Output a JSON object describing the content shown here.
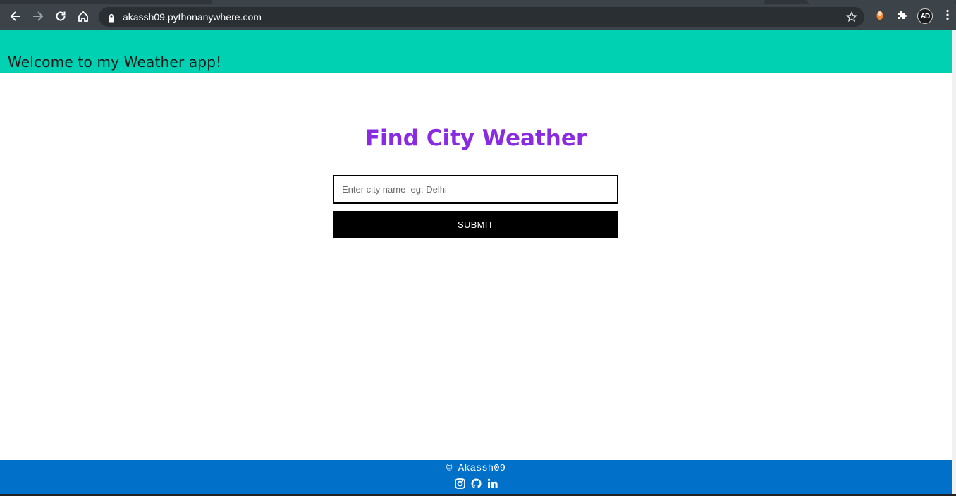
{
  "browser": {
    "url": "akassh09.pythonanywhere.com",
    "profile_initials": "AD",
    "icons": {
      "back": "arrow-left-icon",
      "forward": "arrow-right-icon",
      "reload": "reload-icon",
      "home": "home-icon",
      "lock": "lock-icon",
      "bookmark": "star-icon",
      "extension": "puzzle-icon",
      "menu": "kebab-menu-icon"
    }
  },
  "header": {
    "title": "Welcome to my Weather app!"
  },
  "main": {
    "heading": "Find City Weather",
    "city_input": {
      "value": "",
      "placeholder": "Enter city name  eg: Delhi"
    },
    "submit_label": "SUBMIT"
  },
  "footer": {
    "copyright": "© Akassh09",
    "social_icons": [
      "instagram-icon",
      "github-icon",
      "linkedin-icon"
    ]
  },
  "colors": {
    "header_bg": "#00d1b2",
    "heading": "#8a2be2",
    "footer_bg": "#0070c9",
    "button_bg": "#000000"
  }
}
